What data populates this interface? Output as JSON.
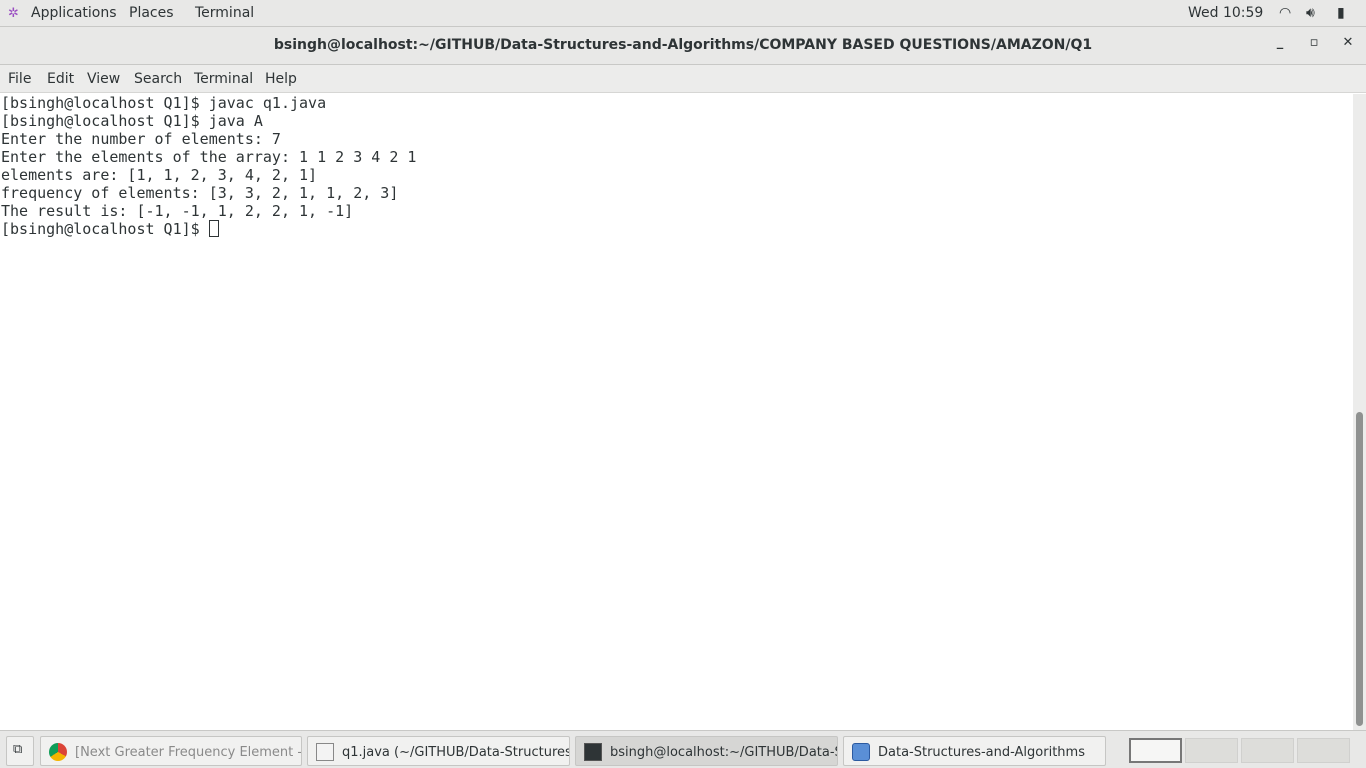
{
  "topbar": {
    "applications": "Applications",
    "places": "Places",
    "terminal": "Terminal",
    "clock": "Wed 10:59"
  },
  "window": {
    "title": "bsingh@localhost:~/GITHUB/Data-Structures-and-Algorithms/COMPANY BASED QUESTIONS/AMAZON/Q1",
    "minimize": "_",
    "maximize": "▫",
    "close": "✕"
  },
  "menu": [
    "File",
    "Edit",
    "View",
    "Search",
    "Terminal",
    "Help"
  ],
  "terminal": {
    "lines": [
      "[bsingh@localhost Q1]$ javac q1.java",
      "[bsingh@localhost Q1]$ java A",
      "Enter the number of elements: 7",
      "Enter the elements of the array: 1 1 2 3 4 2 1",
      "elements are: [1, 1, 2, 3, 4, 2, 1]",
      "frequency of elements: [3, 3, 2, 1, 1, 2, 3]",
      "The result is: [-1, -1, 1, 2, 2, 1, -1]"
    ],
    "prompt": "[bsingh@localhost Q1]$ "
  },
  "taskbar": {
    "tasks": [
      "[Next Greater Frequency Element - ...",
      "q1.java (~/GITHUB/Data-Structures-...",
      "bsingh@localhost:~/GITHUB/Data-S...",
      "Data-Structures-and-Algorithms"
    ]
  }
}
